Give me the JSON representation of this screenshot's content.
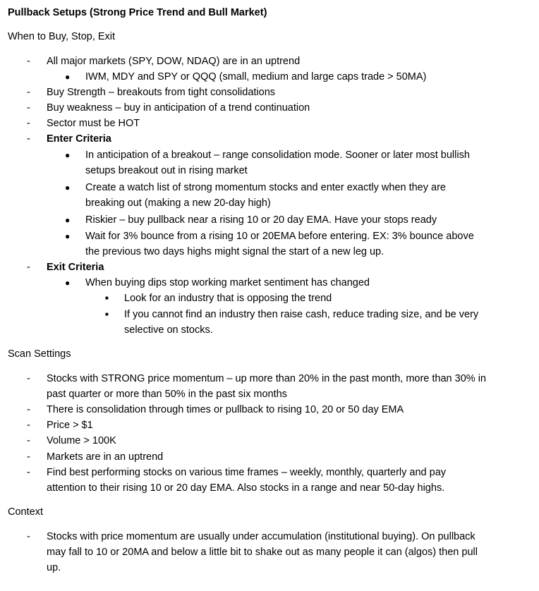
{
  "title": "Pullback Setups (Strong Price Trend and Bull Market)",
  "section1_heading": "When to Buy, Stop, Exit",
  "section1": {
    "item1": "All major markets (SPY, DOW, NDAQ) are in an uptrend",
    "item1_sub1": "IWM, MDY and SPY or QQQ (small, medium and large caps trade > 50MA)",
    "item2": "Buy Strength – breakouts from tight consolidations",
    "item3": "Buy weakness – buy in anticipation of a trend continuation",
    "item4": "Sector must be HOT",
    "enter_label": "Enter Criteria",
    "enter1_line1": "In anticipation of a breakout – range consolidation mode. Sooner or later most bullish",
    "enter1_line2": "setups breakout out in rising market",
    "enter2_line1": "Create a watch list of strong momentum stocks and enter exactly when they are",
    "enter2_line2": "breaking out (making a new 20-day high)",
    "enter3": "Riskier – buy pullback near a rising 10 or 20 day EMA. Have your stops ready",
    "enter4_line1": "Wait for 3% bounce from a rising 10 or 20EMA before entering. EX: 3% bounce above",
    "enter4_line2": "the previous two days highs might signal the start of a new leg up.",
    "exit_label": "Exit Criteria",
    "exit1": "When buying dips stop working market sentiment has changed",
    "exit1_sub1": "Look for an industry that is opposing the trend",
    "exit1_sub2_line1": "If you cannot find an industry then raise cash, reduce trading size, and be very",
    "exit1_sub2_line2": "selective on stocks."
  },
  "section2_heading": "Scan Settings",
  "section2": {
    "item1_line1": "Stocks with STRONG price momentum – up more than 20% in the past month, more than 30% in",
    "item1_line2": "past quarter or more than 50% in the past six months",
    "item2": "There is consolidation through times or pullback to rising 10, 20 or 50 day EMA",
    "item3": "Price > $1",
    "item4": "Volume > 100K",
    "item5": "Markets are in an uptrend",
    "item6_line1": "Find best performing stocks on various time frames – weekly, monthly, quarterly and pay",
    "item6_line2": "attention to their rising 10 or 20 day EMA. Also stocks in a range and near 50-day highs."
  },
  "section3_heading": "Context",
  "section3": {
    "item1_line1": "Stocks with price momentum are usually under accumulation (institutional buying). On pullback",
    "item1_line2": "may fall to 10 or 20MA and below a little bit to shake out as many people it can (algos) then pull",
    "item1_line3": "up."
  },
  "markers": {
    "dash": "-",
    "dot": "●",
    "square": "■"
  }
}
